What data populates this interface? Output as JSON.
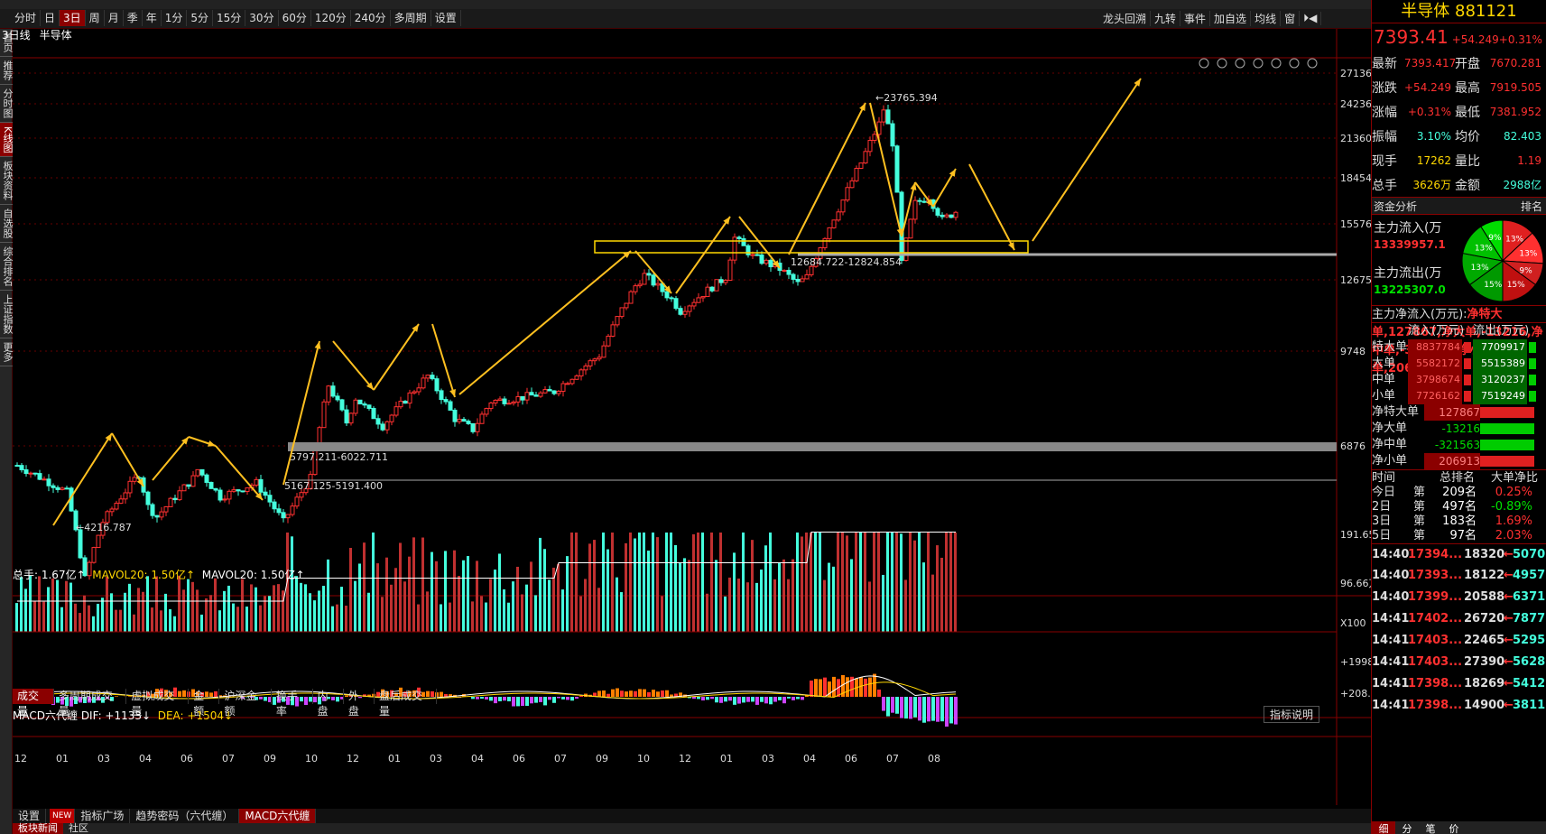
{
  "toolbar": {
    "tabs": [
      "分时",
      "日",
      "3日",
      "周",
      "月",
      "季",
      "年",
      "1分",
      "5分",
      "15分",
      "30分",
      "60分",
      "120分",
      "240分",
      "多周期",
      "设置"
    ],
    "active_tab": "3日",
    "right_tools": [
      "龙头回溯",
      "九转",
      "事件",
      "加自选",
      "均线",
      "窗",
      "⏵◀"
    ]
  },
  "sidebar": {
    "items": [
      "首页",
      "推荐",
      "分时图",
      "K线图",
      "板块资料",
      "自选股",
      "综合排名",
      "上证指数",
      "更多"
    ],
    "active": "K线图"
  },
  "chart": {
    "period": "3日线",
    "name": "半导体",
    "price_axis": [
      "27136",
      "24236",
      "21360",
      "18454",
      "15576",
      "12675",
      "9748",
      "6876"
    ],
    "annotations": {
      "high": "23765.394",
      "low": "4216.787",
      "zone_top": "12684.722-12824.854",
      "zone_mid": "5797.211-6022.711",
      "zone_low": "5167.125-5191.400"
    }
  },
  "chart_data": {
    "type": "candlestick",
    "title": "半导体",
    "y_axis_ticks": [
      27136,
      24236,
      21360,
      18454,
      15576,
      12675,
      9748,
      6876
    ],
    "x_axis_labels": [
      "12",
      "01",
      "03",
      "04",
      "06",
      "07",
      "09",
      "10",
      "12",
      "01",
      "03",
      "04",
      "06",
      "07",
      "09",
      "10",
      "12",
      "01",
      "03",
      "04",
      "06",
      "07",
      "08"
    ],
    "high_label": 23765.394,
    "low_label": 4216.787,
    "support_zones": [
      "12684.722-12824.854",
      "5797.211-6022.711",
      "5167.125-5191.400"
    ],
    "volume_axis": [
      "191.65万",
      "96.66万",
      "X100"
    ],
    "macd_axis": [
      "+1998",
      "+208.0"
    ]
  },
  "volume": {
    "title": "总手: 1.67亿↑",
    "mavol20": "MAVOL20: 1.50亿↑",
    "mavol20b": "MAVOL20: 1.50亿↑",
    "axis": [
      "191.65万",
      "96.66万",
      "X100"
    ],
    "tabs": [
      "成交量",
      "多周期成交量",
      "虚拟成交量",
      "金额",
      "沪深金额",
      "换手率",
      "内盘",
      "外盘",
      "盘后成交量"
    ],
    "active": "成交量"
  },
  "macd": {
    "title": "MACD六代缠",
    "dif": "DIF: +1133↓",
    "dea": "DEA: +1504↓",
    "axis": [
      "+1998",
      "+208.0"
    ],
    "help": "指标说明"
  },
  "bottom": {
    "tabs": [
      "设置",
      "NEW",
      "指标广场",
      "趋势密码（六代缠）",
      "MACD六代缠"
    ],
    "active": "MACD六代缠",
    "tabs2": [
      "板块新闻",
      "社区"
    ]
  },
  "right": {
    "name": "半导体",
    "code": "881121",
    "price": "7393.41",
    "change": "+54.249",
    "pct": "+0.31%",
    "rows": [
      [
        "最新",
        "7393.417",
        "开盘",
        "7670.281"
      ],
      [
        "涨跌",
        "+54.249",
        "最高",
        "7919.505"
      ],
      [
        "涨幅",
        "+0.31%",
        "最低",
        "7381.952"
      ],
      [
        "振幅",
        "3.10%",
        "均价",
        "82.403"
      ],
      [
        "现手",
        "17262",
        "量比",
        "1.19"
      ],
      [
        "总手",
        "3626万",
        "金额",
        "2988亿"
      ]
    ],
    "fund_title": "资金分析",
    "fund_rank": "排名",
    "inflow_label": "主力流入(万",
    "inflow": "13339957.1",
    "outflow_label": "主力流出(万",
    "outflow": "13225307.0",
    "net_label": "主力净流入(万元):",
    "net": [
      [
        "净特大单",
        "127867"
      ],
      [
        "净大单",
        "-13216"
      ],
      [
        "净中单",
        "-321563"
      ],
      [
        "净小单",
        "206913"
      ]
    ],
    "pie": [
      "13%",
      "13%",
      "9%",
      "15%",
      "15%",
      "13%",
      "13%",
      "9%"
    ],
    "flow_header": [
      "流入(万元)",
      "流出(万元)"
    ],
    "flow": [
      [
        "特大单",
        "8837784",
        "7709917"
      ],
      [
        "大单",
        "5582172",
        "5515389"
      ],
      [
        "中单",
        "3798674",
        "3120237"
      ],
      [
        "小单",
        "7726162",
        "7519249"
      ]
    ],
    "rank_header": [
      "时间",
      "总排名",
      "大单净比"
    ],
    "rank": [
      [
        "今日",
        "第",
        "209名",
        "0.25%"
      ],
      [
        "2日",
        "第",
        "497名",
        "-0.89%"
      ],
      [
        "3日",
        "第",
        "183名",
        "1.69%"
      ],
      [
        "5日",
        "第",
        "97名",
        "2.03%"
      ]
    ],
    "ticks": [
      [
        "14:40",
        "17394...",
        "18320",
        "5070"
      ],
      [
        "14:40",
        "17393...",
        "18122",
        "4957"
      ],
      [
        "14:40",
        "17399...",
        "20588",
        "6371"
      ],
      [
        "14:41",
        "17402...",
        "26720",
        "7877"
      ],
      [
        "14:41",
        "17403...",
        "22465",
        "5295"
      ],
      [
        "14:41",
        "17403...",
        "27390",
        "5628"
      ],
      [
        "14:41",
        "17398...",
        "18269",
        "5412"
      ],
      [
        "14:41",
        "17398...",
        "14900",
        "3811"
      ]
    ],
    "bottom_tabs": [
      "细",
      "分",
      "笔",
      "价"
    ]
  }
}
